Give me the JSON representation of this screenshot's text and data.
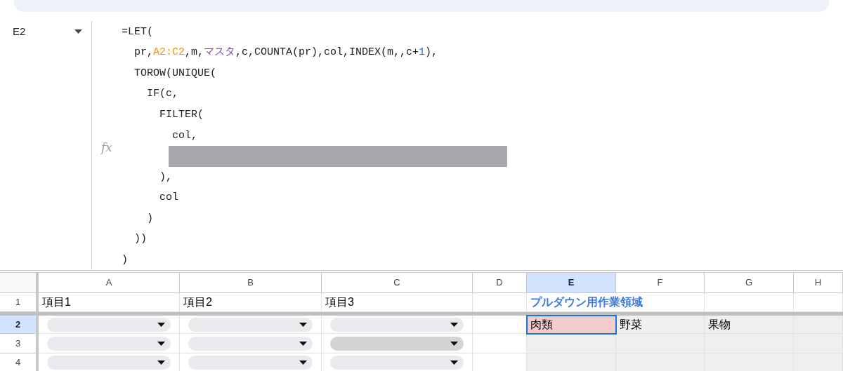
{
  "formula_bar": {
    "name_box": "E2",
    "fx": "fx",
    "lines": [
      {
        "kind": "code",
        "segments": [
          {
            "kind": "plain",
            "text": "=LET("
          }
        ],
        "children": [
          {
            "kind": "code",
            "segments": [
              {
                "kind": "plain",
                "text": "pr,"
              },
              {
                "kind": "range",
                "text": "A2:C2"
              },
              {
                "kind": "plain",
                "text": ",m,"
              },
              {
                "kind": "named",
                "text": "マスタ"
              },
              {
                "kind": "plain",
                "text": ",c,COUNTA(pr),col,INDEX(m,,c+"
              },
              {
                "kind": "number",
                "text": "1"
              },
              {
                "kind": "plain",
                "text": "),"
              }
            ]
          },
          {
            "kind": "code",
            "segments": [
              {
                "kind": "plain",
                "text": "TOROW(UNIQUE("
              }
            ],
            "children": [
              {
                "kind": "code",
                "segments": [
                  {
                    "kind": "plain",
                    "text": "IF(c,"
                  }
                ],
                "children": [
                  {
                    "kind": "code",
                    "segments": [
                      {
                        "kind": "plain",
                        "text": "FILTER("
                      }
                    ],
                    "children": [
                      {
                        "kind": "code",
                        "segments": [
                          {
                            "kind": "plain",
                            "text": "col,"
                          }
                        ]
                      },
                      {
                        "kind": "redacted"
                      }
                    ]
                  },
                  {
                    "kind": "code",
                    "segments": [
                      {
                        "kind": "plain",
                        "text": "),"
                      }
                    ]
                  },
                  {
                    "kind": "code",
                    "segments": [
                      {
                        "kind": "plain",
                        "text": "col"
                      }
                    ]
                  }
                ]
              },
              {
                "kind": "code",
                "segments": [
                  {
                    "kind": "plain",
                    "text": ")"
                  }
                ]
              }
            ]
          },
          {
            "kind": "code",
            "segments": [
              {
                "kind": "plain",
                "text": "))"
              }
            ]
          }
        ]
      },
      {
        "kind": "code",
        "segments": [
          {
            "kind": "plain",
            "text": ")"
          }
        ]
      }
    ]
  },
  "grid": {
    "columns": [
      {
        "label": "A",
        "selected": false
      },
      {
        "label": "B",
        "selected": false
      },
      {
        "label": "C",
        "selected": false
      },
      {
        "label": "D",
        "selected": false
      },
      {
        "label": "E",
        "selected": true
      },
      {
        "label": "F",
        "selected": false
      },
      {
        "label": "G",
        "selected": false
      },
      {
        "label": "H",
        "selected": false
      }
    ],
    "rows": [
      {
        "label": "1",
        "selected": false,
        "cells": [
          {
            "kind": "text",
            "text": "項目1",
            "selected": false
          },
          {
            "kind": "text",
            "text": "項目2",
            "selected": false
          },
          {
            "kind": "text",
            "text": "項目3",
            "selected": false
          },
          {
            "kind": "empty",
            "selected": false
          },
          {
            "kind": "title",
            "text": "プルダウン用作業領域",
            "overflow": true,
            "selected": false
          },
          {
            "kind": "empty",
            "selected": false
          },
          {
            "kind": "empty",
            "selected": false
          }
        ]
      },
      {
        "label": "2",
        "selected": true,
        "cells": [
          {
            "kind": "dropdown",
            "hover": false,
            "selected": false
          },
          {
            "kind": "dropdown",
            "hover": false,
            "selected": false
          },
          {
            "kind": "dropdown",
            "hover": false,
            "selected": false
          },
          {
            "kind": "empty",
            "selected": false
          },
          {
            "kind": "text",
            "text": "肉類",
            "color": "#f4cccc",
            "selected": true
          },
          {
            "kind": "text",
            "text": "野菜",
            "color": "#efefef",
            "selected": false
          },
          {
            "kind": "text",
            "text": "果物",
            "color": "#efefef",
            "selected": false
          },
          {
            "kind": "empty",
            "color": "#efefef",
            "selected": false
          }
        ]
      },
      {
        "label": "3",
        "selected": false,
        "cells": [
          {
            "kind": "dropdown",
            "hover": false,
            "selected": false
          },
          {
            "kind": "dropdown",
            "hover": false,
            "selected": false
          },
          {
            "kind": "dropdown",
            "hover": true,
            "selected": false
          },
          {
            "kind": "empty",
            "selected": false
          },
          {
            "kind": "empty",
            "color": "#efefef",
            "selected": false
          },
          {
            "kind": "empty",
            "color": "#efefef",
            "selected": false
          },
          {
            "kind": "empty",
            "color": "#efefef",
            "selected": false
          },
          {
            "kind": "empty",
            "color": "#efefef",
            "selected": false
          }
        ]
      },
      {
        "label": "4",
        "selected": false,
        "cells": [
          {
            "kind": "dropdown",
            "hover": false,
            "selected": false
          },
          {
            "kind": "dropdown",
            "hover": false,
            "selected": false
          },
          {
            "kind": "dropdown",
            "hover": false,
            "selected": false
          },
          {
            "kind": "empty",
            "selected": false
          },
          {
            "kind": "empty",
            "color": "#efefef",
            "selected": false
          },
          {
            "kind": "empty",
            "color": "#efefef",
            "selected": false
          },
          {
            "kind": "empty",
            "color": "#efefef",
            "selected": false
          },
          {
            "kind": "empty",
            "color": "#efefef",
            "selected": false
          }
        ]
      }
    ]
  }
}
